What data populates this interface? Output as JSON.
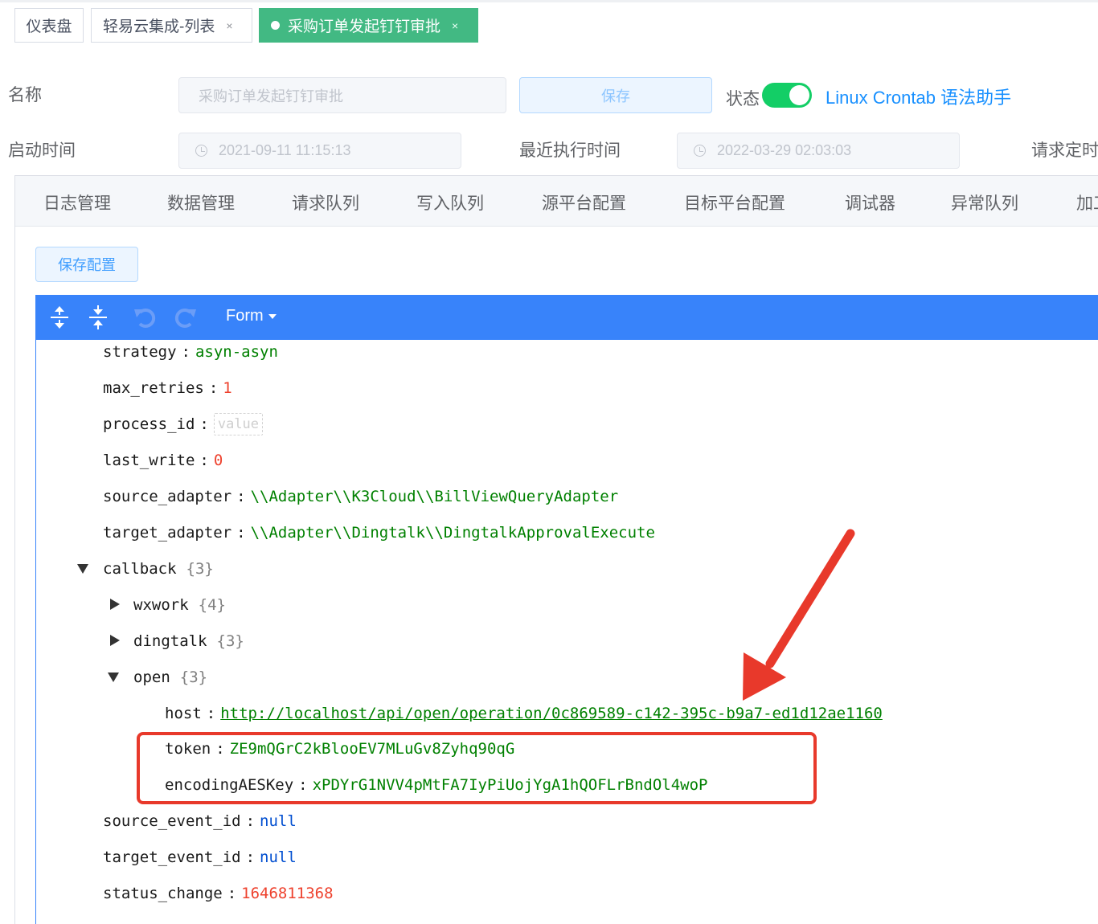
{
  "tabs": [
    {
      "label": "仪表盘",
      "closable": false,
      "active": false
    },
    {
      "label": "轻易云集成-列表",
      "closable": true,
      "active": false
    },
    {
      "label": "采购订单发起钉钉审批",
      "closable": true,
      "active": true
    }
  ],
  "close_glyph": "×",
  "form": {
    "name_label": "名称",
    "name_placeholder": "采购订单发起钉钉审批",
    "save_label": "保存",
    "status_label": "状态",
    "status_on": true,
    "crontab_link": "Linux Crontab 语法助手",
    "start_time_label": "启动时间",
    "start_time_value": "2021-09-11 11:15:13",
    "last_exec_label": "最近执行时间",
    "last_exec_value": "2022-03-29 02:03:03",
    "request_timer_label": "请求定时"
  },
  "panel_tabs": [
    "日志管理",
    "数据管理",
    "请求队列",
    "写入队列",
    "源平台配置",
    "目标平台配置",
    "调试器",
    "异常队列",
    "加工"
  ],
  "save_config_label": "保存配置",
  "editor": {
    "mode_label": "Form",
    "icons": [
      "expand-all-icon",
      "collapse-all-icon",
      "undo-icon",
      "redo-icon"
    ],
    "rows": [
      {
        "key": "strategy",
        "type": "string",
        "value": "asyn-asyn"
      },
      {
        "key": "max_retries",
        "type": "number",
        "value": "1"
      },
      {
        "key": "process_id",
        "type": "empty",
        "value": "value"
      },
      {
        "key": "last_write",
        "type": "number",
        "value": "0"
      },
      {
        "key": "source_adapter",
        "type": "string",
        "value": "\\\\Adapter\\\\K3Cloud\\\\BillViewQueryAdapter"
      },
      {
        "key": "target_adapter",
        "type": "string",
        "value": "\\\\Adapter\\\\Dingtalk\\\\DingtalkApprovalExecute"
      },
      {
        "key": "callback",
        "type": "object",
        "count": "{3}",
        "expanded": true
      },
      {
        "key": "wxwork",
        "type": "object",
        "count": "{4}",
        "expanded": false
      },
      {
        "key": "dingtalk",
        "type": "object",
        "count": "{3}",
        "expanded": false
      },
      {
        "key": "open",
        "type": "object",
        "count": "{3}",
        "expanded": true
      },
      {
        "key": "host",
        "type": "url",
        "value": "http://localhost/api/open/operation/0c869589-c142-395c-b9a7-ed1d12ae1160"
      },
      {
        "key": "token",
        "type": "string",
        "value": "ZE9mQGrC2kBlooEV7MLuGv8Zyhq90qG"
      },
      {
        "key": "encodingAESKey",
        "type": "string",
        "value": "xPDYrG1NVV4pMtFA7IyPiUojYgA1hQOFLrBndOl4woP"
      },
      {
        "key": "source_event_id",
        "type": "null",
        "value": "null"
      },
      {
        "key": "target_event_id",
        "type": "null",
        "value": "null"
      },
      {
        "key": "status_change",
        "type": "number",
        "value": "1646811368"
      }
    ]
  },
  "colors": {
    "accent": "#3883fa",
    "active_tab": "#42b983",
    "switch_on": "#13ce66",
    "link": "#1890ff",
    "annotation": "#e8392b"
  }
}
